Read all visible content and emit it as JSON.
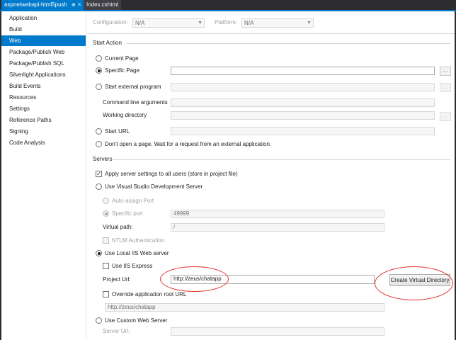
{
  "tabs": [
    {
      "label": "aspnetwebapi-html5push",
      "pin": "⊕",
      "close": "×"
    },
    {
      "label": "Index.cshtml"
    }
  ],
  "sidebar": {
    "items": [
      {
        "label": "Application"
      },
      {
        "label": "Build"
      },
      {
        "label": "Web"
      },
      {
        "label": "Package/Publish Web"
      },
      {
        "label": "Package/Publish SQL"
      },
      {
        "label": "Silverlight Applications"
      },
      {
        "label": "Build Events"
      },
      {
        "label": "Resources"
      },
      {
        "label": "Settings"
      },
      {
        "label": "Reference Paths"
      },
      {
        "label": "Signing"
      },
      {
        "label": "Code Analysis"
      }
    ],
    "selected": "Web"
  },
  "config_bar": {
    "configuration_label": "Configuration:",
    "configuration_value": "N/A",
    "platform_label": "Platform:",
    "platform_value": "N/A"
  },
  "start_action": {
    "heading": "Start Action",
    "current_page": "Current Page",
    "specific_page": "Specific Page",
    "specific_page_value": "",
    "external_program": "Start external program",
    "command_line_arguments": "Command line arguments",
    "working_directory": "Working directory",
    "start_url": "Start URL",
    "dont_open": "Don't open a page.  Wait for a request from an external application.",
    "browse": "...",
    "selected": "Specific Page"
  },
  "servers": {
    "heading": "Servers",
    "apply_settings": "Apply server settings to all users (store in project file)",
    "apply_checked": true,
    "use_vs_dev_server": "Use Visual Studio Development Server",
    "auto_assign_port": "Auto-assign Port",
    "specific_port": "Specific port",
    "port_value": "49999",
    "virtual_path_label": "Virtual path:",
    "virtual_path_value": "/",
    "ntlm": "NTLM Authentication",
    "use_local_iis": "Use Local IIS Web server",
    "use_iis_express": "Use IIS Express",
    "project_url_label": "Project Url:",
    "project_url_value": "http://zeus/chatapp",
    "create_virtual_directory": "Create Virtual Directory",
    "override_root_url": "Override application root URL",
    "override_root_url_value": "http://zeus/chatapp",
    "use_custom_web_server": "Use Custom Web Server",
    "server_url_label": "Server Url:",
    "selected": "Use Local IIS Web server"
  },
  "colors": {
    "accent": "#007acc",
    "highlight_circle": "#e0302a"
  }
}
